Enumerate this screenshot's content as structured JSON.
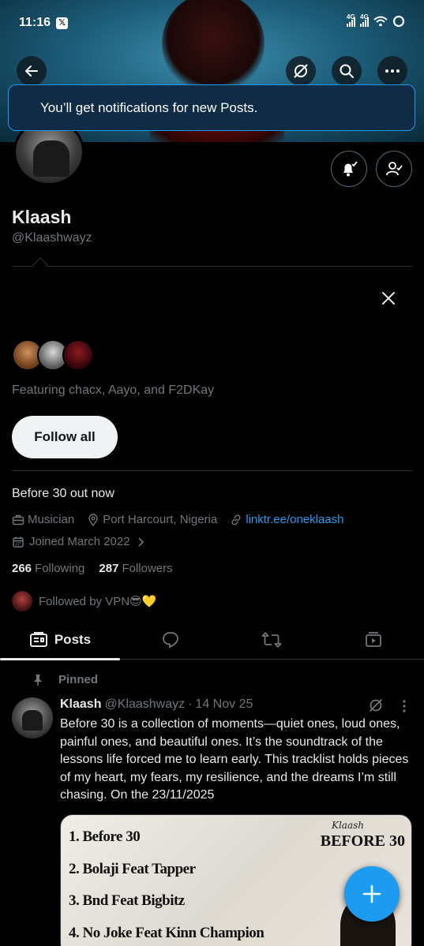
{
  "status_bar": {
    "time": "11:16",
    "network_1": "4G",
    "network_2": "4G"
  },
  "header": {
    "back_icon": "arrow-left-icon",
    "grok_icon": "grok-slash-icon",
    "search_icon": "search-icon",
    "more_icon": "more-horizontal-icon"
  },
  "toast": {
    "message": "You’ll get notifications for new Posts."
  },
  "profile": {
    "name": "Klaash",
    "handle": "@Klaashwayz",
    "bio": "Before 30 out now",
    "profession": "Musician",
    "location": "Port Harcourt, Nigeria",
    "link": "linktr.ee/oneklaash",
    "joined": "Joined March 2022",
    "following_count": "266",
    "following_label": "Following",
    "followers_count": "287",
    "followers_label": "Followers",
    "followed_by": "Followed by VPN😎💛"
  },
  "suggestions": {
    "featuring": "Featuring chacx, Aayo, and F2DKay",
    "follow_all_label": "Follow all"
  },
  "tabs": {
    "posts_label": "Posts"
  },
  "post": {
    "pinned_label": "Pinned",
    "author_name": "Klaash",
    "author_handle": "@Klaashwayz",
    "separator": "·",
    "date": "14 Nov 25",
    "text": "Before 30 is a collection of moments—quiet ones, loud ones, painful ones, and beautiful ones. It’s the soundtrack of the lessons life forced me to learn early. This tracklist holds pieces of my heart, my fears, my resilience, and the dreams I’m still chasing. On the 23/11/2025",
    "media": {
      "signature": "Klaash",
      "album_title": "BEFORE 30",
      "tracks": [
        "1. Before 30",
        "2. Bolaji Feat Tapper",
        "3. Bnd Feat Bigbitz",
        "4. No Joke Feat Kinn Champion"
      ]
    }
  },
  "colors": {
    "accent": "#1d9bf0",
    "background": "#000000",
    "secondary_text": "#71767b",
    "toast_bg": "#102b46"
  }
}
